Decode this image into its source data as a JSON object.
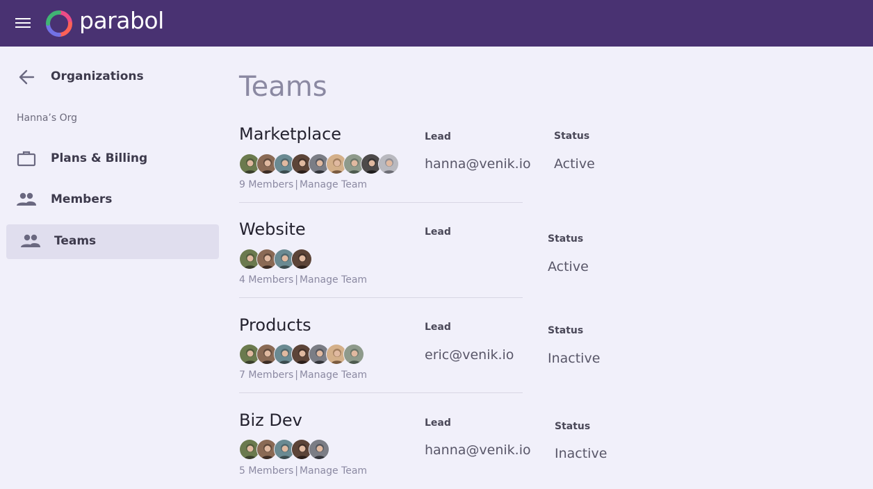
{
  "header": {
    "brand": "parabol",
    "menu_icon": "hamburger-icon",
    "logo_icon": "parabol-logo-icon"
  },
  "sidebar": {
    "back_label": "Organizations",
    "org_name": "Hanna’s Org",
    "items": [
      {
        "label": "Plans & Billing",
        "icon": "briefcase-icon",
        "active": false
      },
      {
        "label": "Members",
        "icon": "people-icon",
        "active": false
      },
      {
        "label": "Teams",
        "icon": "people-icon",
        "active": true
      }
    ]
  },
  "main": {
    "title": "Teams",
    "lead_label": "Lead",
    "status_label": "Status",
    "manage_label": "Manage Team",
    "teams": [
      {
        "name": "Marketplace",
        "members_text": "9 Members",
        "member_count": 9,
        "lead": "hanna@venik.io",
        "status": "Active"
      },
      {
        "name": "Website",
        "members_text": "4 Members",
        "member_count": 4,
        "lead": "",
        "status": "Active"
      },
      {
        "name": "Products",
        "members_text": "7 Members",
        "member_count": 7,
        "lead": "eric@venik.io",
        "status": "Inactive"
      },
      {
        "name": "Biz Dev",
        "members_text": "5 Members",
        "member_count": 5,
        "lead": "hanna@venik.io",
        "status": "Inactive"
      }
    ]
  },
  "colors": {
    "topbar": "#493272",
    "background": "#F1F0FA",
    "active_nav": "#E0DEEE",
    "title": "#8b89a2"
  }
}
